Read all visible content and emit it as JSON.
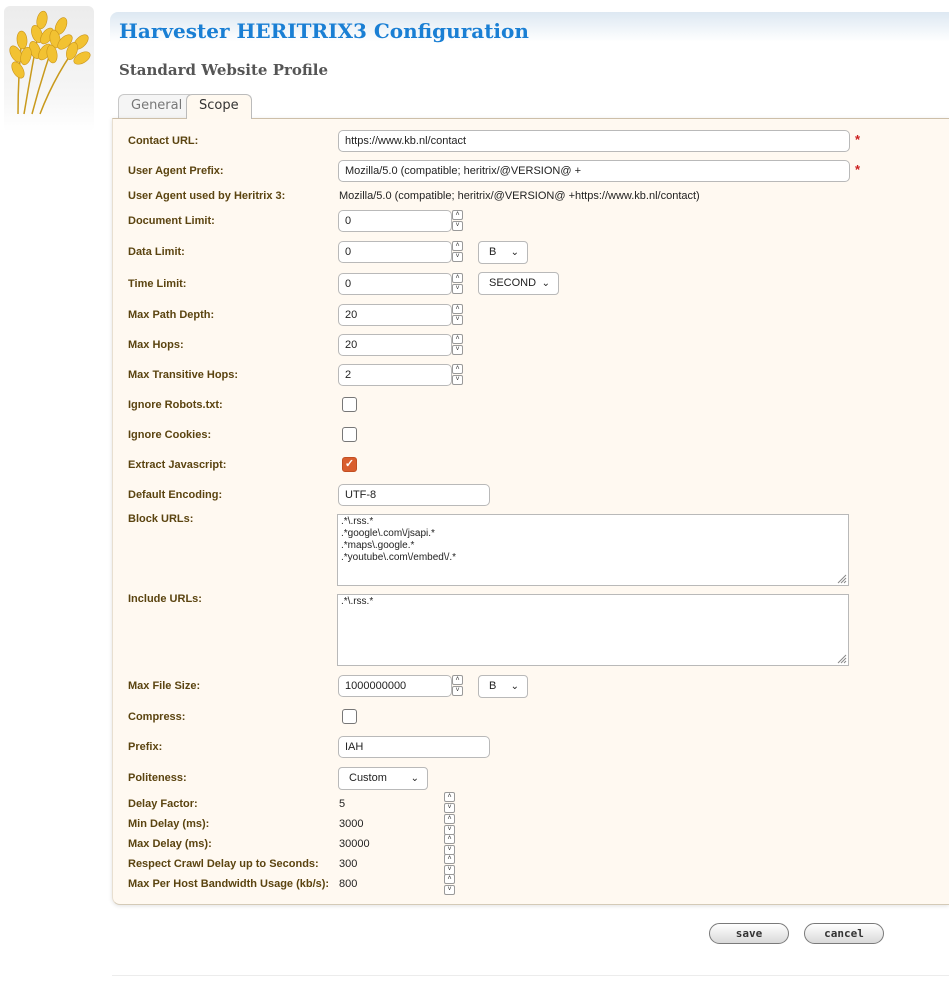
{
  "header": {
    "app_title": "Harvester HERITRIX3 Configuration",
    "profile_title": "Standard Website Profile"
  },
  "tabs": [
    {
      "label": "General",
      "active": false
    },
    {
      "label": "Scope",
      "active": true
    }
  ],
  "form": {
    "contact_url": {
      "label": "Contact URL:",
      "value": "https://www.kb.nl/contact",
      "required": "*"
    },
    "user_agent_prefix": {
      "label": "User Agent Prefix:",
      "value": "Mozilla/5.0 (compatible; heritrix/@VERSION@ +",
      "required": "*"
    },
    "user_agent_used": {
      "label": "User Agent used by Heritrix 3:",
      "value": "Mozilla/5.0 (compatible; heritrix/@VERSION@ +https://www.kb.nl/contact)"
    },
    "document_limit": {
      "label": "Document Limit:",
      "value": "0"
    },
    "data_limit": {
      "label": "Data Limit:",
      "value": "0",
      "unit": "B"
    },
    "time_limit": {
      "label": "Time Limit:",
      "value": "0",
      "unit": "SECOND"
    },
    "max_path_depth": {
      "label": "Max Path Depth:",
      "value": "20"
    },
    "max_hops": {
      "label": "Max Hops:",
      "value": "20"
    },
    "max_transitive_hops": {
      "label": "Max Transitive Hops:",
      "value": "2"
    },
    "ignore_robots": {
      "label": "Ignore Robots.txt:",
      "checked": false
    },
    "ignore_cookies": {
      "label": "Ignore Cookies:",
      "checked": false
    },
    "extract_javascript": {
      "label": "Extract Javascript:",
      "checked": true,
      "check_glyph": "✓"
    },
    "default_encoding": {
      "label": "Default Encoding:",
      "value": "UTF-8"
    },
    "block_urls": {
      "label": "Block URLs:",
      "value": ".*\\.rss.*\n.*google\\.com\\/jsapi.*\n.*maps\\.google.*\n.*youtube\\.com\\/embed\\/.*"
    },
    "include_urls": {
      "label": "Include URLs:",
      "value": ".*\\.rss.*"
    },
    "max_file_size": {
      "label": "Max File Size:",
      "value": "1000000000",
      "unit": "B"
    },
    "compress": {
      "label": "Compress:",
      "checked": false
    },
    "prefix": {
      "label": "Prefix:",
      "value": "IAH"
    },
    "politeness": {
      "label": "Politeness:",
      "value": "Custom"
    },
    "delay_factor": {
      "label": "Delay Factor:",
      "value": "5"
    },
    "min_delay": {
      "label": "Min Delay (ms):",
      "value": "3000"
    },
    "max_delay": {
      "label": "Max Delay (ms):",
      "value": "30000"
    },
    "respect_crawl_delay": {
      "label": "Respect Crawl Delay up to Seconds:",
      "value": "300"
    },
    "max_host_bandwidth": {
      "label": "Max Per Host Bandwidth Usage (kb/s):",
      "value": "800"
    }
  },
  "actions": {
    "save_label": "save",
    "cancel_label": "cancel"
  },
  "icons": {
    "logo": "wheat-logo-icon",
    "spinner_up": "˄",
    "spinner_down": "˅",
    "chevron": "⌄"
  },
  "colors": {
    "title": "#1a7fd4",
    "label": "#5b4410",
    "panel_bg": "#fff9f1",
    "required": "#cc1f1f",
    "checkbox_checked": "#d95e2e"
  }
}
